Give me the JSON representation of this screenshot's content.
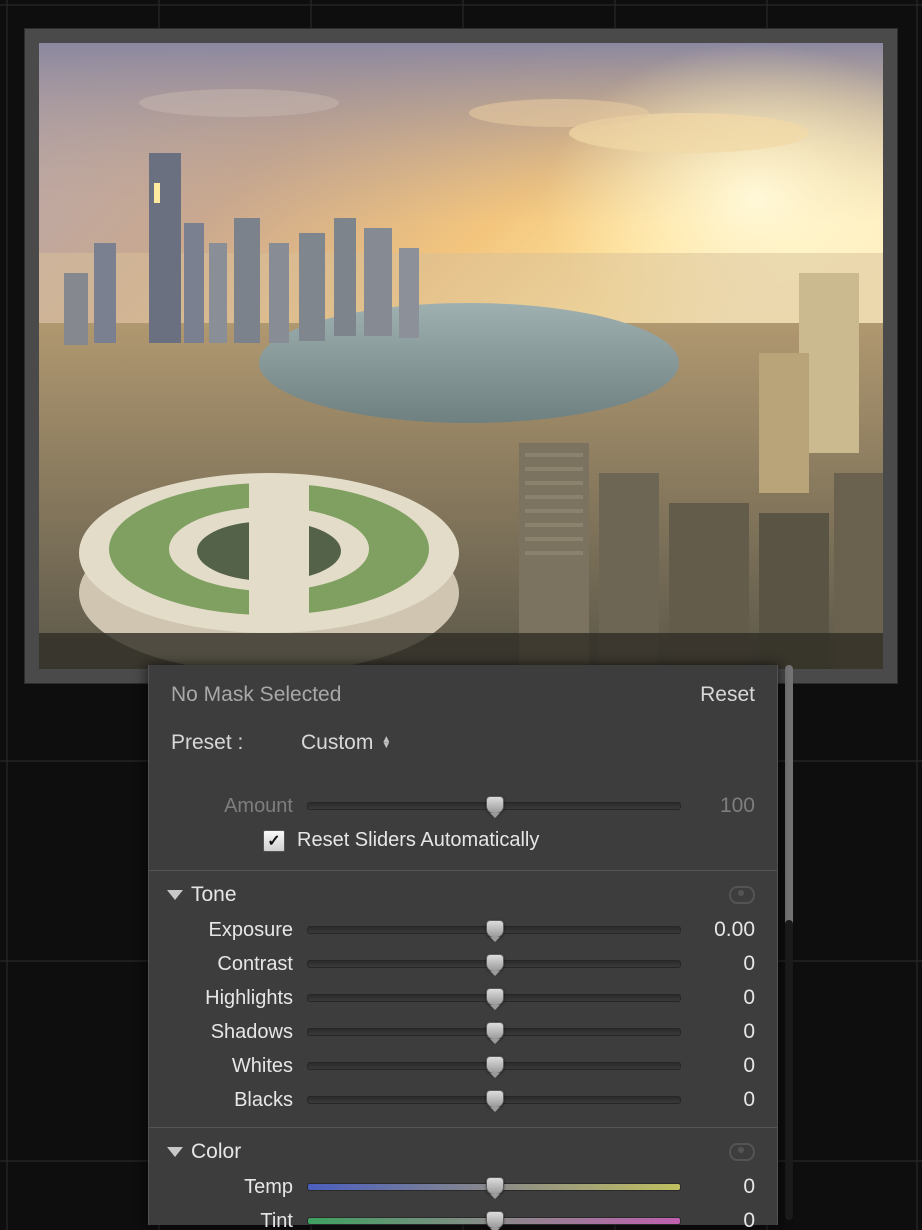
{
  "status_text": "No Mask Selected",
  "reset_label": "Reset",
  "preset_label": "Preset :",
  "preset_value": "Custom",
  "amount": {
    "label": "Amount",
    "value": "100"
  },
  "reset_checkbox": {
    "checked": true,
    "label": "Reset Sliders Automatically"
  },
  "sections": {
    "tone": {
      "title": "Tone",
      "rows": [
        {
          "label": "Exposure",
          "value": "0.00"
        },
        {
          "label": "Contrast",
          "value": "0"
        },
        {
          "label": "Highlights",
          "value": "0"
        },
        {
          "label": "Shadows",
          "value": "0"
        },
        {
          "label": "Whites",
          "value": "0"
        },
        {
          "label": "Blacks",
          "value": "0"
        }
      ]
    },
    "color": {
      "title": "Color",
      "rows": [
        {
          "label": "Temp",
          "value": "0"
        },
        {
          "label": "Tint",
          "value": "0"
        }
      ]
    }
  }
}
